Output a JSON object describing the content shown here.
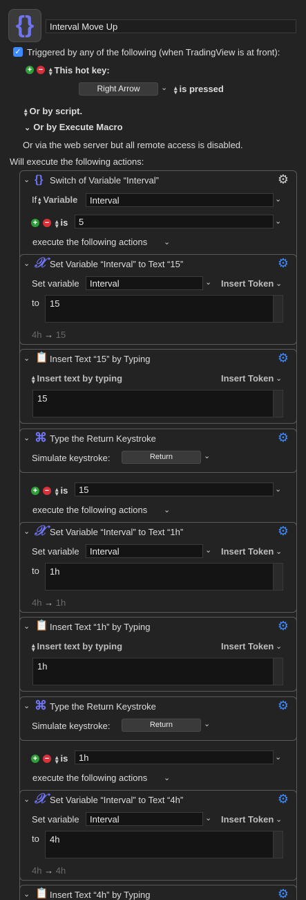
{
  "macro": {
    "name": "Interval Move Up",
    "trigger_label": "Triggered by any of the following (when TradingView is at front):",
    "hotkey_label": "This hot key:",
    "hotkey_value": "Right Arrow",
    "hotkey_state": "is pressed",
    "or_script": "Or by script.",
    "or_execute": "Or by Execute Macro",
    "web_server": "Or via the web server but all remote access is disabled.",
    "will_execute": "Will execute the following actions:"
  },
  "switch": {
    "title": "Switch of Variable “Interval”",
    "if_label": "If",
    "variable_label": "Variable",
    "variable_value": "Interval",
    "is_label": "is",
    "execute_label": "execute the following actions"
  },
  "cases": [
    {
      "value": "5",
      "set": {
        "title": "Set Variable “Interval” to Text “15”",
        "set_label": "Set variable",
        "var": "Interval",
        "insert_token": "Insert Token",
        "to_label": "to",
        "to_value": "15",
        "preview_from": "4h",
        "preview_arrow": "→",
        "preview_to": "15"
      },
      "insert": {
        "title": "Insert Text “15” by Typing",
        "mode": "Insert text by typing",
        "insert_token": "Insert Token",
        "text": "15"
      },
      "type": {
        "title": "Type the Return Keystroke",
        "sim_label": "Simulate keystroke:",
        "key": "Return"
      }
    },
    {
      "value": "15",
      "set": {
        "title": "Set Variable “Interval” to Text “1h”",
        "set_label": "Set variable",
        "var": "Interval",
        "insert_token": "Insert Token",
        "to_label": "to",
        "to_value": "1h",
        "preview_from": "4h",
        "preview_arrow": "→",
        "preview_to": "1h"
      },
      "insert": {
        "title": "Insert Text “1h” by Typing",
        "mode": "Insert text by typing",
        "insert_token": "Insert Token",
        "text": "1h"
      },
      "type": {
        "title": "Type the Return Keystroke",
        "sim_label": "Simulate keystroke:",
        "key": "Return"
      }
    },
    {
      "value": "1h",
      "set": {
        "title": "Set Variable “Interval” to Text “4h”",
        "set_label": "Set variable",
        "var": "Interval",
        "insert_token": "Insert Token",
        "to_label": "to",
        "to_value": "4h",
        "preview_from": "4h",
        "preview_arrow": "→",
        "preview_to": "4h"
      },
      "insert": {
        "title": "Insert Text “4h” by Typing"
      }
    }
  ],
  "icons": {
    "macro": "curly-braces-icon",
    "switch": "curly-braces-icon",
    "set_variable": "x-variable-icon",
    "insert_text": "clipboard-icon",
    "type_keystroke": "command-key-icon",
    "gear": "gear-icon"
  },
  "colors": {
    "accent": "#3d8bff",
    "icon_purple": "#6f74f0",
    "plus": "#2f9e3a",
    "minus": "#d9303a"
  }
}
